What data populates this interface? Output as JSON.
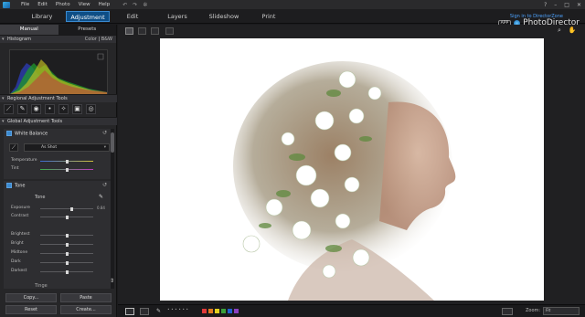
{
  "menu": {
    "items": [
      "File",
      "Edit",
      "Photo",
      "View",
      "Help"
    ]
  },
  "tabs": {
    "items": [
      "Library",
      "Adjustment",
      "Edit",
      "Layers",
      "Slideshow",
      "Print"
    ],
    "active": "Adjustment"
  },
  "header": {
    "signin": "Sign in to DirectorZone",
    "app_badge": "APP",
    "brand": "PhotoDirector"
  },
  "left_panel": {
    "subtabs": [
      "Manual",
      "Presets"
    ],
    "histogram": {
      "title": "Histogram",
      "mode_color": "Color",
      "mode_bw": "B&W"
    },
    "regional_title": "Regional Adjustment Tools",
    "global_title": "Global Adjustment Tools",
    "white_balance": {
      "title": "White Balance",
      "preset": "As Shot",
      "sliders": [
        {
          "label": "Temperature",
          "value": 0.5
        },
        {
          "label": "Tint",
          "value": 0.5
        }
      ]
    },
    "tone": {
      "title": "Tone",
      "subtitle": "Tone",
      "sliders": [
        {
          "label": "Exposure",
          "value": 0.6,
          "readout": "0.84"
        },
        {
          "label": "Contrast",
          "value": 0.5,
          "readout": ""
        },
        {
          "label": "Brightest",
          "value": 0.5,
          "readout": ""
        },
        {
          "label": "Bright",
          "value": 0.5,
          "readout": ""
        },
        {
          "label": "Midtone",
          "value": 0.5,
          "readout": ""
        },
        {
          "label": "Dark",
          "value": 0.5,
          "readout": ""
        },
        {
          "label": "Darkest",
          "value": 0.5,
          "readout": ""
        }
      ],
      "footer": "Tinge"
    },
    "buttons": {
      "copy": "Copy...",
      "paste": "Paste",
      "reset": "Reset",
      "create": "Create..."
    }
  },
  "statusbar": {
    "zoom_label": "Zoom:",
    "zoom_value": "Fit",
    "swatches": [
      "#e03a3a",
      "#e07a20",
      "#e0d020",
      "#3aa03a",
      "#2060d0",
      "#8a40c0"
    ]
  }
}
